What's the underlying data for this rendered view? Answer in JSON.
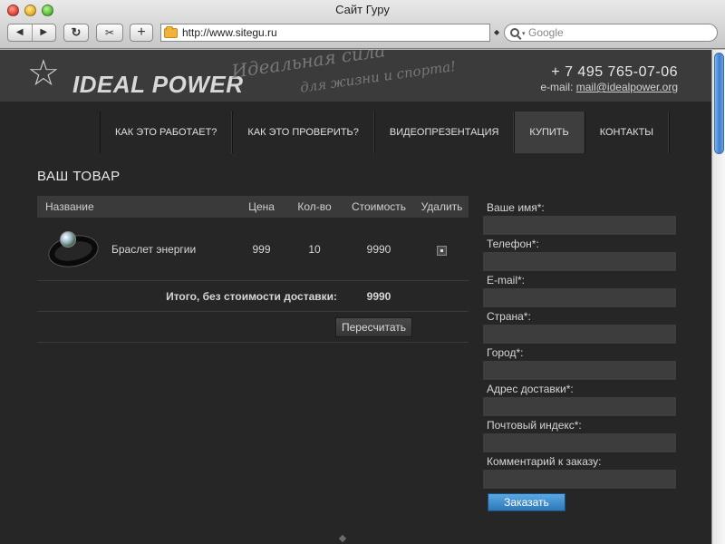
{
  "window": {
    "title": "Сайт Гуру"
  },
  "toolbar": {
    "back_glyph": "◀",
    "forward_glyph": "▶",
    "reload_glyph": "↻",
    "snip_glyph": "✂",
    "add_glyph": "+"
  },
  "address_bar": {
    "url": "http://www.sitegu.ru"
  },
  "search": {
    "placeholder": "Google"
  },
  "site": {
    "logo_text": "IDEAL POWER",
    "slogan_line1": "Идеальная сила",
    "slogan_line2": "для жизни и спорта!",
    "phone": "+ 7 495 765-07-06",
    "email_label": "e-mail:",
    "email": "mail@idealpower.org"
  },
  "menu": {
    "items": [
      {
        "label": "КАК ЭТО РАБОТАЕТ?"
      },
      {
        "label": "КАК ЭТО ПРОВЕРИТЬ?"
      },
      {
        "label": "ВИДЕОПРЕЗЕНТАЦИЯ"
      },
      {
        "label": "КУПИТЬ",
        "active": true
      },
      {
        "label": "КОНТАКТЫ"
      }
    ]
  },
  "cart": {
    "title": "ВАШ ТОВАР",
    "columns": {
      "name": "Название",
      "price": "Цена",
      "qty": "Кол-во",
      "cost": "Стоимость",
      "delete": "Удалить"
    },
    "items": [
      {
        "name": "Браслет энергии",
        "price": "999",
        "qty": "10",
        "cost": "9990"
      }
    ],
    "total_label": "Итого, без стоимости доставки:",
    "total_value": "9990",
    "recalc_label": "Пересчитать"
  },
  "order_form": {
    "fields": [
      {
        "label": "Ваше имя*:"
      },
      {
        "label": "Телефон*:"
      },
      {
        "label": "E-mail*:"
      },
      {
        "label": "Страна*:"
      },
      {
        "label": "Город*:"
      },
      {
        "label": "Адрес доставки*:"
      },
      {
        "label": "Почтовый индекс*:"
      },
      {
        "label": "Комментарий к заказу:"
      }
    ],
    "submit_label": "Заказать"
  },
  "colors": {
    "page_bg": "#262626",
    "header_bg": "#3b3b3b",
    "accent": "#3b82c4"
  }
}
